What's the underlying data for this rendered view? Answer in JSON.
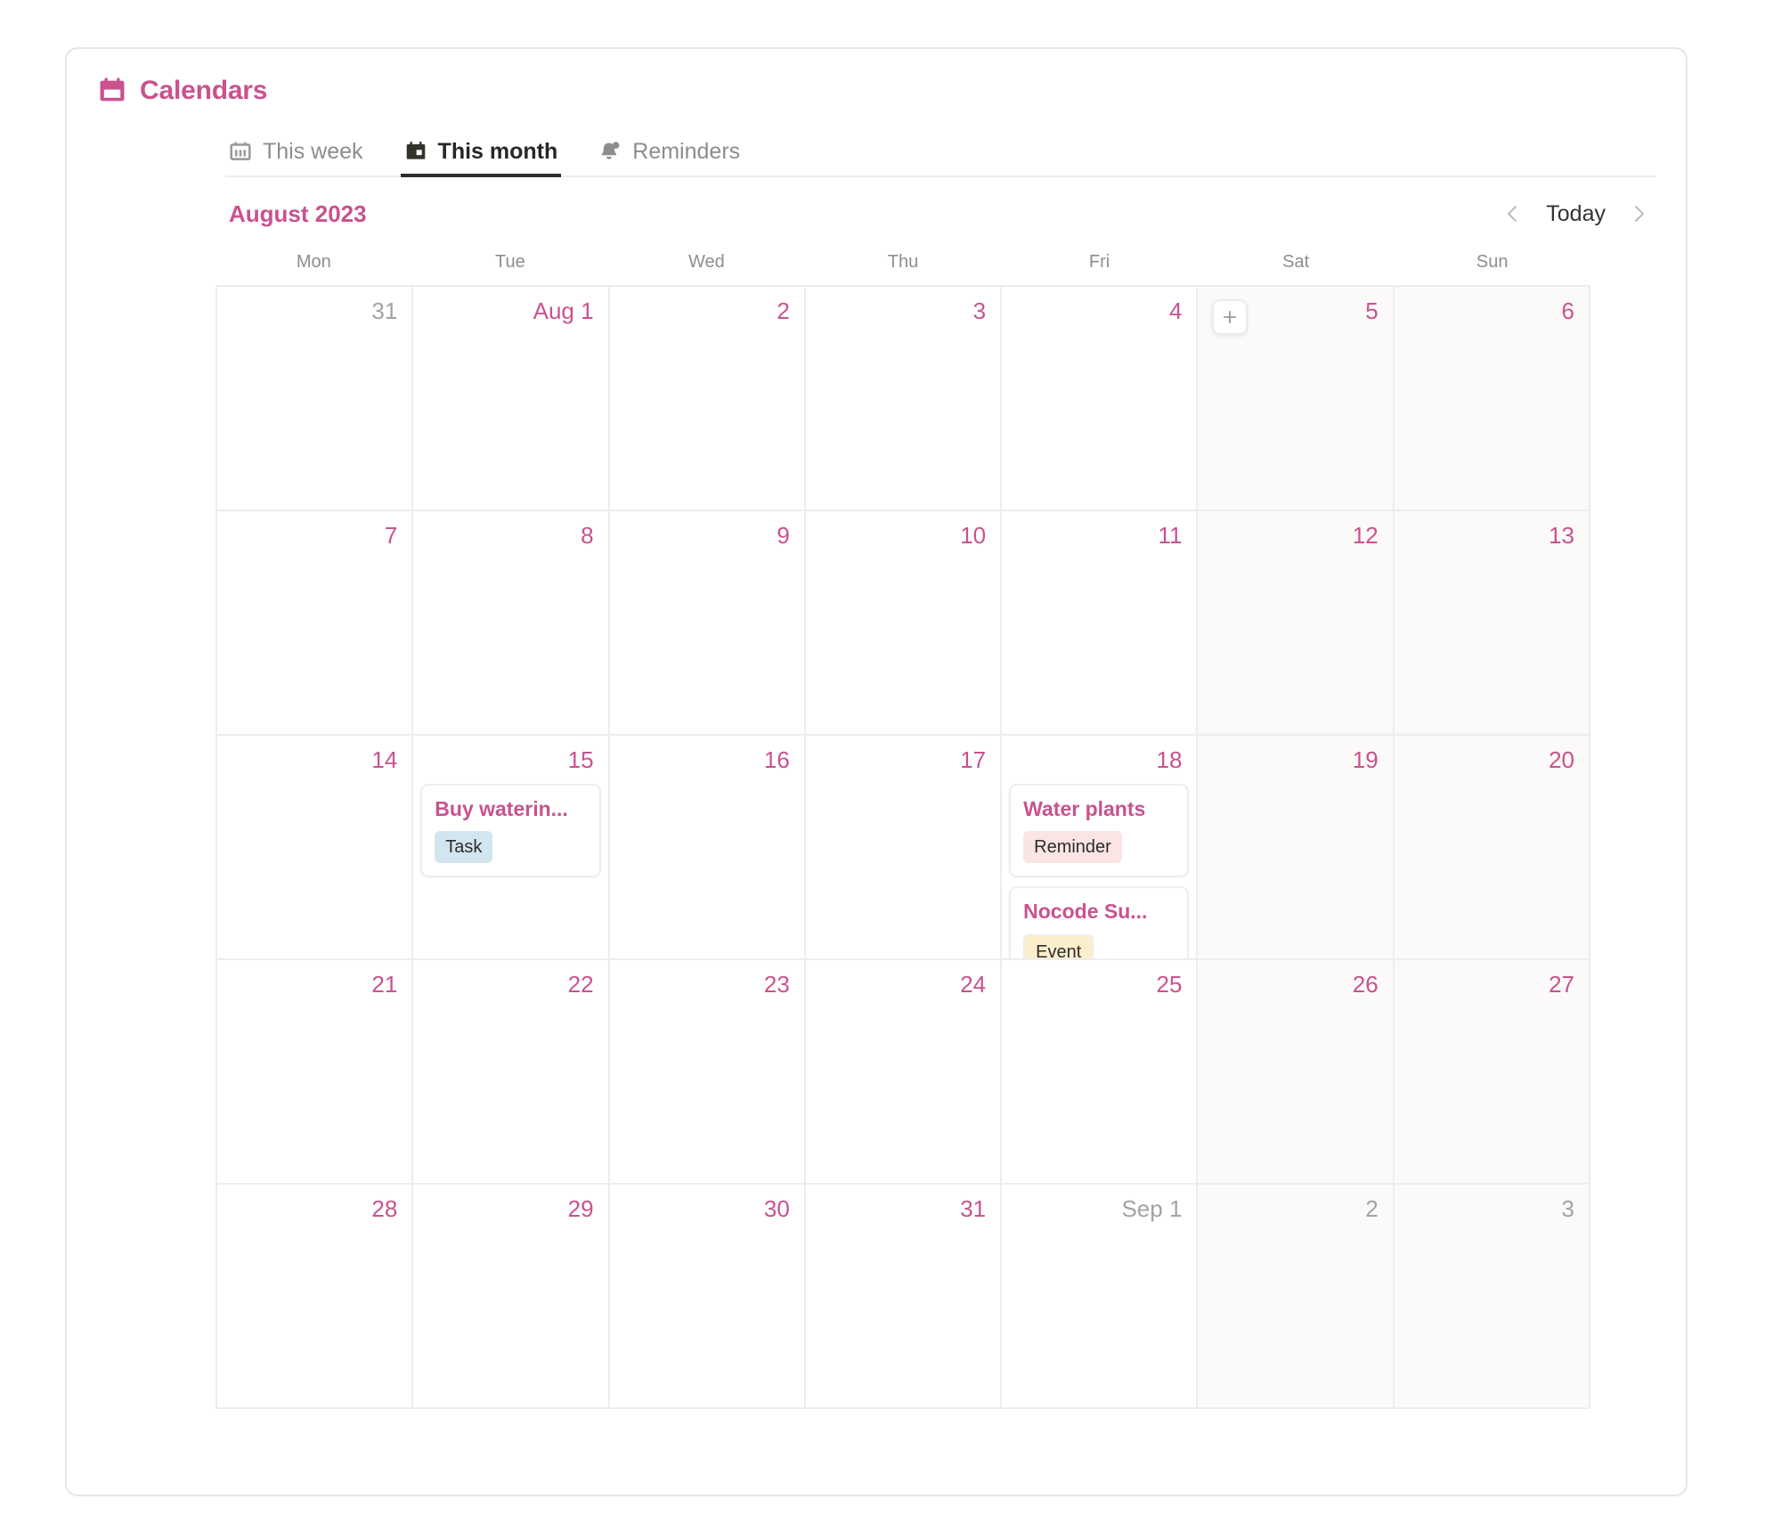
{
  "header": {
    "title": "Calendars",
    "icon": "calendar-icon",
    "accent_color": "#c9528f"
  },
  "tabs": [
    {
      "label": "This week",
      "icon": "calendar-week-icon",
      "active": false
    },
    {
      "label": "This month",
      "icon": "calendar-month-icon",
      "active": true
    },
    {
      "label": "Reminders",
      "icon": "bell-icon",
      "active": false
    }
  ],
  "month_bar": {
    "month_label": "August 2023",
    "prev_label": "‹",
    "today_label": "Today",
    "next_label": "›"
  },
  "weekdays": [
    "Mon",
    "Tue",
    "Wed",
    "Thu",
    "Fri",
    "Sat",
    "Sun"
  ],
  "add_button": {
    "label": "+",
    "day": 5
  },
  "weeks": [
    [
      {
        "num": "31",
        "out": true,
        "weekend": false,
        "events": []
      },
      {
        "num": "Aug 1",
        "out": false,
        "weekend": false,
        "events": []
      },
      {
        "num": "2",
        "out": false,
        "weekend": false,
        "events": []
      },
      {
        "num": "3",
        "out": false,
        "weekend": false,
        "events": []
      },
      {
        "num": "4",
        "out": false,
        "weekend": false,
        "events": []
      },
      {
        "num": "5",
        "out": false,
        "weekend": true,
        "events": [],
        "add": true
      },
      {
        "num": "6",
        "out": false,
        "weekend": true,
        "events": []
      }
    ],
    [
      {
        "num": "7",
        "out": false,
        "weekend": false,
        "events": []
      },
      {
        "num": "8",
        "out": false,
        "weekend": false,
        "events": []
      },
      {
        "num": "9",
        "out": false,
        "weekend": false,
        "events": []
      },
      {
        "num": "10",
        "out": false,
        "weekend": false,
        "events": []
      },
      {
        "num": "11",
        "out": false,
        "weekend": false,
        "events": []
      },
      {
        "num": "12",
        "out": false,
        "weekend": true,
        "events": []
      },
      {
        "num": "13",
        "out": false,
        "weekend": true,
        "events": []
      }
    ],
    [
      {
        "num": "14",
        "out": false,
        "weekend": false,
        "events": []
      },
      {
        "num": "15",
        "out": false,
        "weekend": false,
        "events": [
          {
            "title": "Buy waterin...",
            "badge": "Task",
            "badge_type": "task"
          }
        ]
      },
      {
        "num": "16",
        "out": false,
        "weekend": false,
        "events": []
      },
      {
        "num": "17",
        "out": false,
        "weekend": false,
        "events": []
      },
      {
        "num": "18",
        "out": false,
        "weekend": false,
        "events": [
          {
            "title": "Water plants",
            "badge": "Reminder",
            "badge_type": "reminder"
          },
          {
            "title": "Nocode Su...",
            "badge": "Event",
            "badge_type": "event"
          }
        ]
      },
      {
        "num": "19",
        "out": false,
        "weekend": true,
        "events": []
      },
      {
        "num": "20",
        "out": false,
        "weekend": true,
        "events": []
      }
    ],
    [
      {
        "num": "21",
        "out": false,
        "weekend": false,
        "events": []
      },
      {
        "num": "22",
        "out": false,
        "weekend": false,
        "events": []
      },
      {
        "num": "23",
        "out": false,
        "weekend": false,
        "events": []
      },
      {
        "num": "24",
        "out": false,
        "weekend": false,
        "events": []
      },
      {
        "num": "25",
        "out": false,
        "weekend": false,
        "events": []
      },
      {
        "num": "26",
        "out": false,
        "weekend": true,
        "events": []
      },
      {
        "num": "27",
        "out": false,
        "weekend": true,
        "events": []
      }
    ],
    [
      {
        "num": "28",
        "out": false,
        "weekend": false,
        "events": []
      },
      {
        "num": "29",
        "out": false,
        "weekend": false,
        "events": []
      },
      {
        "num": "30",
        "out": false,
        "weekend": false,
        "events": []
      },
      {
        "num": "31",
        "out": false,
        "weekend": false,
        "events": []
      },
      {
        "num": "Sep 1",
        "out": true,
        "weekend": false,
        "events": []
      },
      {
        "num": "2",
        "out": true,
        "weekend": true,
        "events": []
      },
      {
        "num": "3",
        "out": true,
        "weekend": true,
        "events": []
      }
    ]
  ],
  "badge_colors": {
    "task": "#d3e5ef",
    "reminder": "#fbe4e4",
    "event": "#fbeeca"
  }
}
